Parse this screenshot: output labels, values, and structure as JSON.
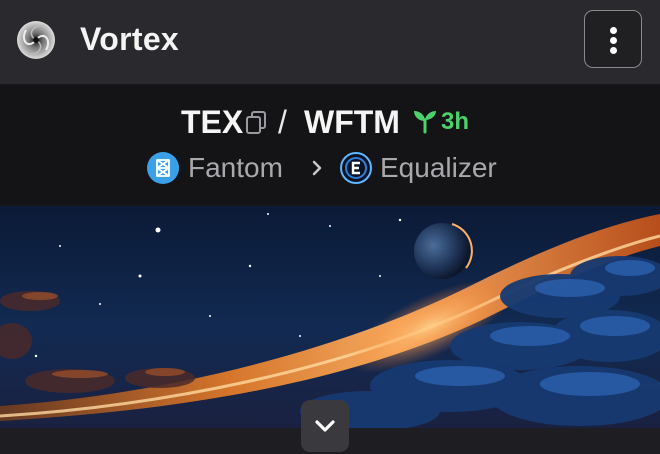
{
  "header": {
    "title": "Vortex",
    "logo_icon": "vortex-logo",
    "menu_icon": "more-vertical-icon"
  },
  "pair": {
    "base": "TEX",
    "separator": "/",
    "quote": "WFTM",
    "age": "3h",
    "chain": "Fantom",
    "dex": "Equalizer"
  },
  "colors": {
    "age_green": "#4dd16a",
    "chain_blue": "#3aa0e8",
    "muted_text": "#a8a8ad"
  },
  "banner": {
    "description_icon": "space-banner-image"
  },
  "expand": {
    "icon": "chevron-down-icon"
  }
}
